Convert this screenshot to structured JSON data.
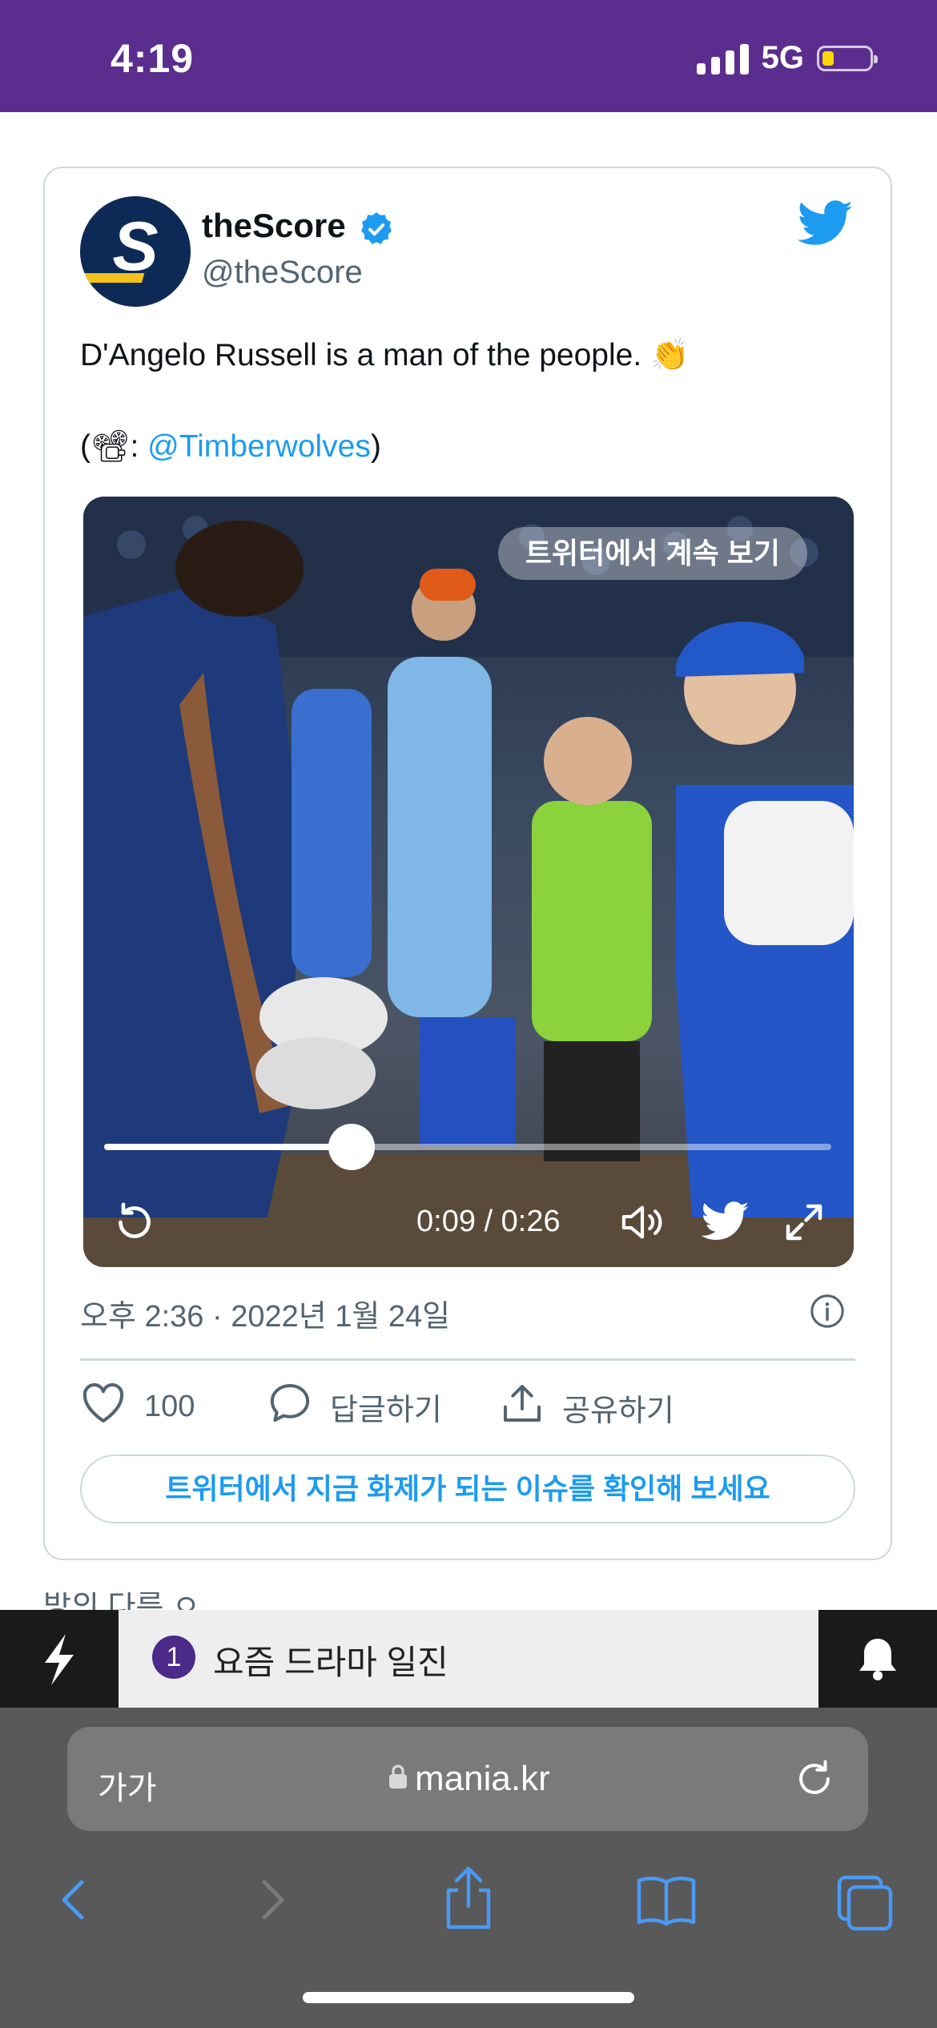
{
  "status_bar": {
    "time": "4:19",
    "network": "5G",
    "background": "#5b2d8f"
  },
  "tweet": {
    "display_name": "theScore",
    "handle": "@theScore",
    "text_line1": "D'Angelo Russell is a man of the people. 👏",
    "text_line2_prefix": "(📽: ",
    "mention": "@Timberwolves",
    "text_line2_suffix": ")",
    "continue_label": "트위터에서 계속 보기",
    "video_time": "0:09 / 0:26",
    "progress": 0.34,
    "timestamp": "오후 2:36 · 2022년 1월 24일",
    "likes": "100",
    "reply_label": "답글하기",
    "share_label": "공유하기",
    "cta_label": "트위터에서 지금 화제가 되는 이슈를 확인해 보세요",
    "accent": "#1d9bf0",
    "icons": [
      "verified-badge-icon",
      "twitter-bird-icon",
      "replay-icon",
      "volume-icon",
      "fullscreen-icon",
      "info-icon",
      "heart-icon",
      "reply-bubble-icon",
      "share-icon"
    ]
  },
  "peek_text": "방의 다른 ㅇ",
  "trending": {
    "rank": "1",
    "label": "요즘 드라마 일진",
    "icons": [
      "lightning-icon",
      "bell-icon"
    ]
  },
  "browser": {
    "aa_label": "가가",
    "url": "mania.kr",
    "icons": [
      "lock-icon",
      "reload-icon",
      "back-icon",
      "forward-icon",
      "share-icon",
      "bookmarks-icon",
      "tabs-icon"
    ]
  }
}
